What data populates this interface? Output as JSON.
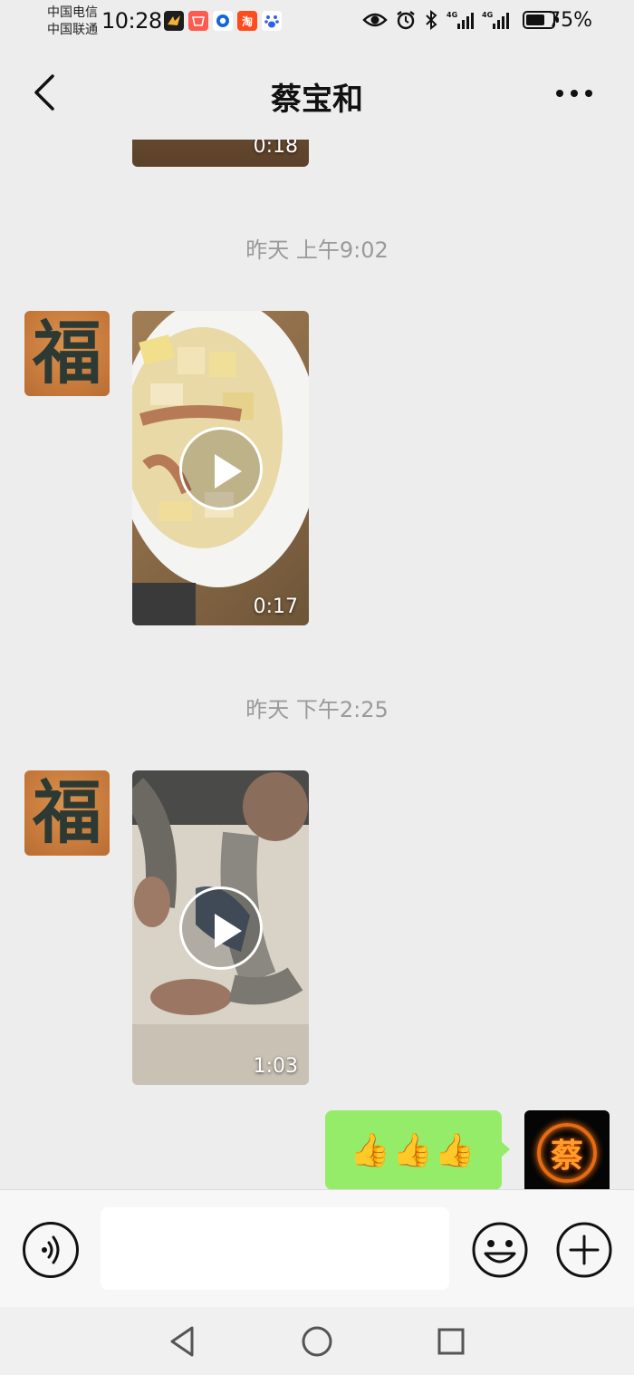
{
  "status_bar": {
    "carrier_1": "中国电信",
    "carrier_2": "中国联通",
    "time": "10:28",
    "app_icons": [
      "game-icon",
      "aliexpress-icon",
      "browser-icon",
      "taobao-icon",
      "baidu-icon"
    ],
    "taobao_glyph": "淘",
    "network_1": "4G",
    "network_2": "4G",
    "battery_percent": "75%",
    "battery_level": 0.75
  },
  "header": {
    "title": "蔡宝和"
  },
  "messages": [
    {
      "type": "video",
      "sender": "contact",
      "duration": "0:18",
      "partial": true
    },
    {
      "type": "timestamp",
      "text": "昨天 上午9:02"
    },
    {
      "type": "video",
      "sender": "contact",
      "duration": "0:17"
    },
    {
      "type": "timestamp",
      "text": "昨天 下午2:25"
    },
    {
      "type": "video",
      "sender": "contact",
      "duration": "1:03"
    },
    {
      "type": "text",
      "sender": "me",
      "text": "👍👍👍"
    }
  ],
  "avatars": {
    "contact_glyph": "福",
    "me_glyph": "蔡"
  },
  "input_bar": {
    "value": "",
    "placeholder": ""
  },
  "colors": {
    "background": "#ededed",
    "my_bubble": "#95ec69",
    "timestamp": "#9a9a9a"
  }
}
